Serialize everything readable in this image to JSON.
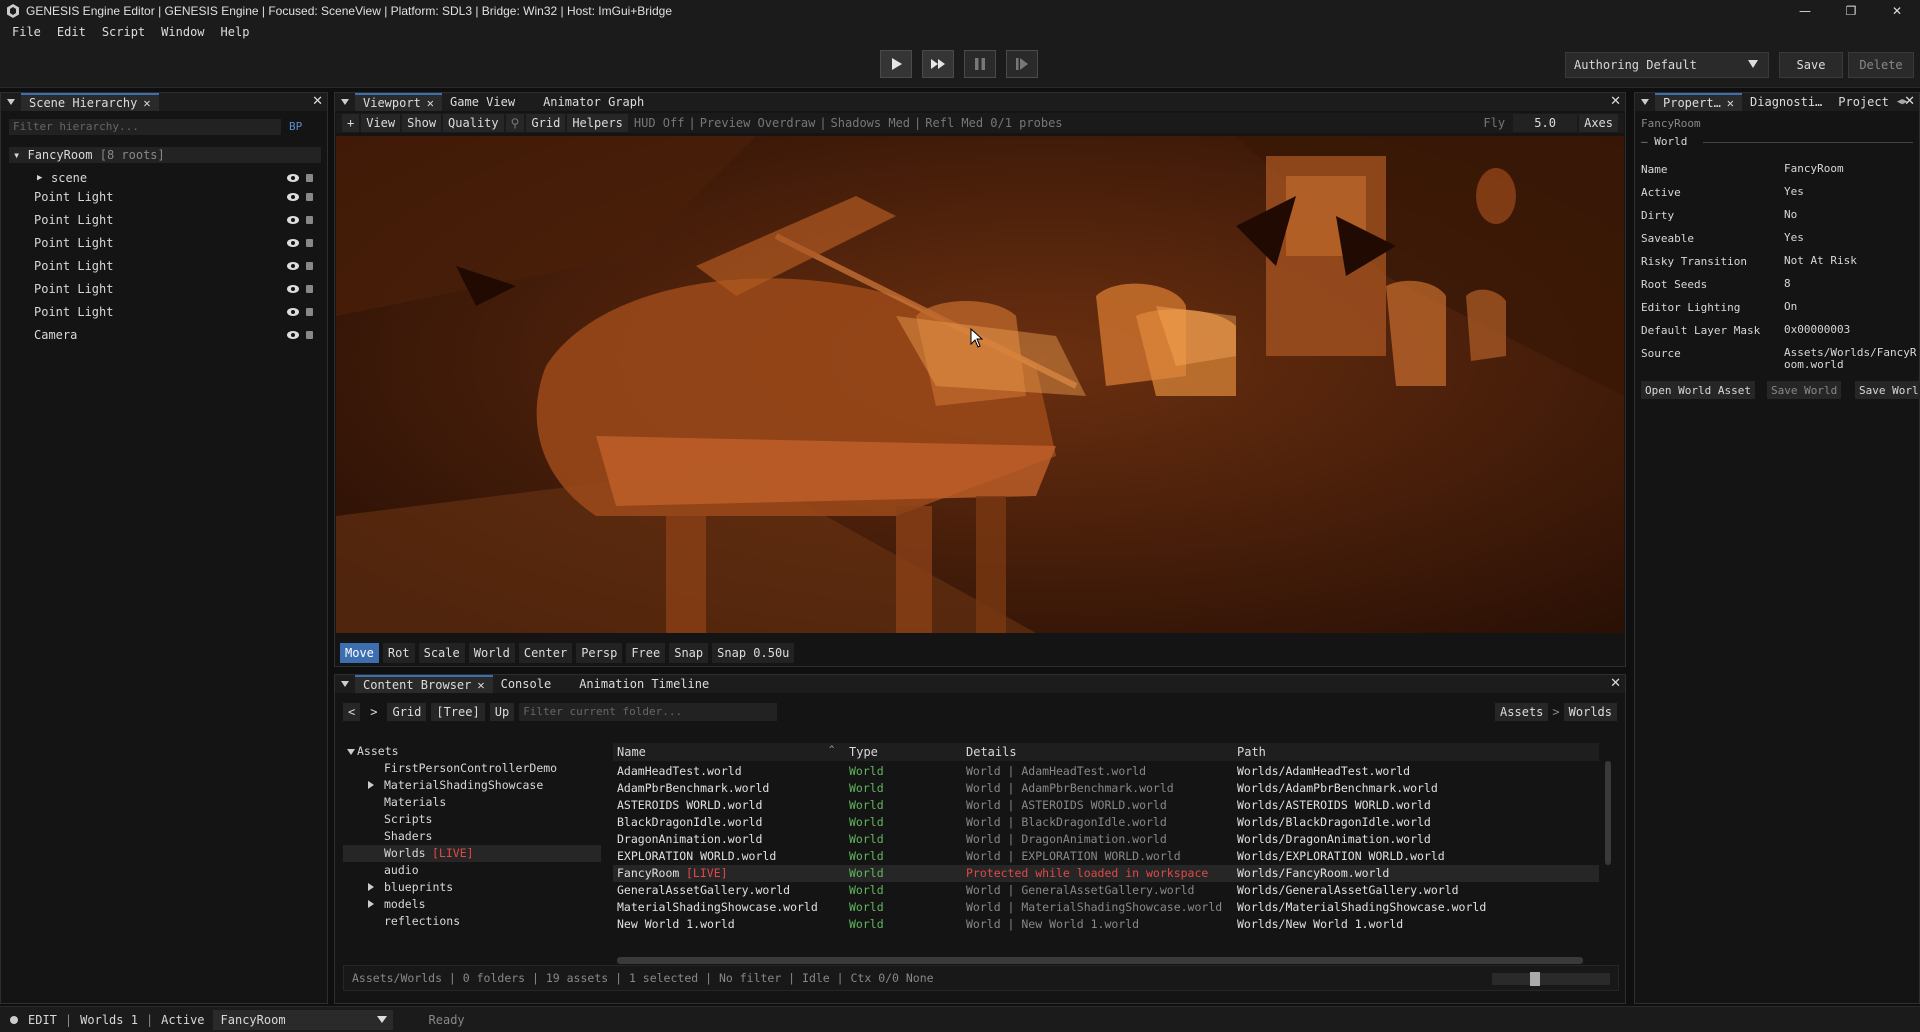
{
  "window": {
    "title": "GENESIS Engine Editor | GENESIS Engine | Focused: SceneView | Platform: SDL3 | Bridge: Win32 | Host: ImGui+Bridge",
    "controls": [
      "—",
      "❐",
      "✕"
    ]
  },
  "menu": [
    "File",
    "Edit",
    "Script",
    "Window",
    "Help"
  ],
  "toolbar": {
    "layout": "Authoring Default",
    "save": "Save",
    "delete": "Delete",
    "play_icons": [
      "play-icon",
      "fast-forward-icon",
      "pause-icon",
      "step-icon"
    ]
  },
  "hierarchy": {
    "tab": "Scene Hierarchy",
    "filter_placeholder": "Filter hierarchy...",
    "bp": "BP",
    "root_name": "FancyRoom",
    "root_count": "[8 roots]",
    "items": [
      "scene",
      "Point Light",
      "Point Light",
      "Point Light",
      "Point Light",
      "Point Light",
      "Point Light",
      "Camera"
    ]
  },
  "viewport": {
    "tabs": [
      "Viewport",
      "Game View",
      "Animator Graph"
    ],
    "tools": [
      "+",
      "View",
      "Show",
      "Quality",
      "Grid",
      "Helpers"
    ],
    "hud": "HUD Off",
    "preview": "Preview Overdraw",
    "shadows": "Shadows Med",
    "refl": "Refl Med 0/1 probes",
    "fly_label": "Fly",
    "fly_value": "5.0",
    "axes": "Axes",
    "gizmo": [
      "Move",
      "Rot",
      "Scale",
      "World",
      "Center",
      "Persp",
      "Free",
      "Snap",
      "Snap 0.50u"
    ]
  },
  "properties": {
    "tabs": [
      "Propert…",
      "Diagnosti…",
      "Project"
    ],
    "object": "FancyRoom",
    "section": "World",
    "rows": [
      {
        "k": "Name",
        "v": "FancyRoom"
      },
      {
        "k": "Active",
        "v": "Yes"
      },
      {
        "k": "Dirty",
        "v": "No"
      },
      {
        "k": "Saveable",
        "v": "Yes"
      },
      {
        "k": "Risky Transition",
        "v": "Not At Risk"
      },
      {
        "k": "Root Seeds",
        "v": "8"
      },
      {
        "k": "Editor Lighting",
        "v": "On"
      },
      {
        "k": "Default Layer Mask",
        "v": "0x00000003"
      },
      {
        "k": "Source",
        "v": "Assets/Worlds/FancyRoom.world"
      }
    ],
    "buttons": [
      "Open World Asset",
      "Save World",
      "Save Worl"
    ]
  },
  "content": {
    "tabs": [
      "Content Browser",
      "Console",
      "Animation Timeline"
    ],
    "nav": [
      "<",
      ">",
      "Grid",
      "[Tree]",
      "Up"
    ],
    "filter_placeholder": "Filter current folder...",
    "crumbs": [
      "Assets",
      ">",
      "Worlds"
    ],
    "tree": [
      {
        "label": "Assets",
        "arrow": "down"
      },
      {
        "label": "FirstPersonControllerDemo",
        "arrow": ""
      },
      {
        "label": "MaterialShadingShowcase",
        "arrow": "right"
      },
      {
        "label": "Materials",
        "arrow": ""
      },
      {
        "label": "Scripts",
        "arrow": ""
      },
      {
        "label": "Shaders",
        "arrow": ""
      },
      {
        "label": "Worlds",
        "arrow": "",
        "tag": "[LIVE]"
      },
      {
        "label": "audio",
        "arrow": ""
      },
      {
        "label": "blueprints",
        "arrow": "right"
      },
      {
        "label": "models",
        "arrow": "right"
      },
      {
        "label": "reflections",
        "arrow": ""
      }
    ],
    "columns": [
      "Name",
      "Type",
      "Details",
      "Path"
    ],
    "sort_indicator": "^",
    "rows": [
      {
        "name": "AdamHeadTest.world",
        "type": "World",
        "details": "World | AdamHeadTest.world",
        "path": "Worlds/AdamHeadTest.world"
      },
      {
        "name": "AdamPbrBenchmark.world",
        "type": "World",
        "details": "World | AdamPbrBenchmark.world",
        "path": "Worlds/AdamPbrBenchmark.world"
      },
      {
        "name": "ASTEROIDS WORLD.world",
        "type": "World",
        "details": "World | ASTEROIDS WORLD.world",
        "path": "Worlds/ASTEROIDS WORLD.world"
      },
      {
        "name": "BlackDragonIdle.world",
        "type": "World",
        "details": "World | BlackDragonIdle.world",
        "path": "Worlds/BlackDragonIdle.world"
      },
      {
        "name": "DragonAnimation.world",
        "type": "World",
        "details": "World | DragonAnimation.world",
        "path": "Worlds/DragonAnimation.world"
      },
      {
        "name": "EXPLORATION WORLD.world",
        "type": "World",
        "details": "World | EXPLORATION WORLD.world",
        "path": "Worlds/EXPLORATION WORLD.world"
      },
      {
        "name": "FancyRoom",
        "tag": "[LIVE]",
        "type": "World",
        "details": "Protected while loaded in workspace",
        "path": "Worlds/FancyRoom.world",
        "selected": true
      },
      {
        "name": "GeneralAssetGallery.world",
        "type": "World",
        "details": "World | GeneralAssetGallery.world",
        "path": "Worlds/GeneralAssetGallery.world"
      },
      {
        "name": "MaterialShadingShowcase.world",
        "type": "World",
        "details": "World | MaterialShadingShowcase.world",
        "path": "Worlds/MaterialShadingShowcase.world"
      },
      {
        "name": "New World 1.world",
        "type": "World",
        "details": "World | New World 1.world",
        "path": "Worlds/New World 1.world"
      }
    ],
    "status": "Assets/Worlds | 0 folders | 19 assets | 1 selected | No filter | Idle | Ctx 0/0 None"
  },
  "statusbar": {
    "mode": "EDIT",
    "worlds": "Worlds 1",
    "active": "Active",
    "world": "FancyRoom",
    "state": "Ready"
  },
  "colors": {
    "accent": "#3d6fb0",
    "live": "#e04848",
    "type_green": "#5fb85f",
    "scene_orange": "#e8782a"
  }
}
